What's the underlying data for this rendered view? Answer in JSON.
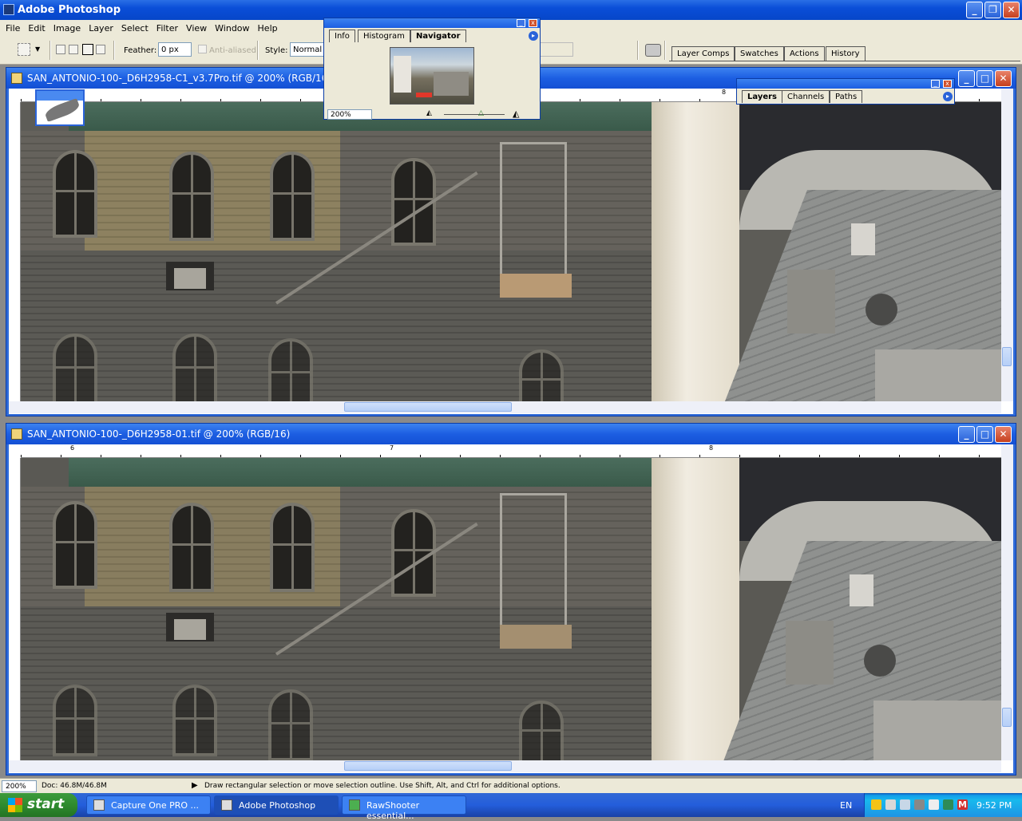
{
  "app": {
    "title": "Adobe Photoshop"
  },
  "menu": [
    "File",
    "Edit",
    "Image",
    "Layer",
    "Select",
    "Filter",
    "View",
    "Window",
    "Help"
  ],
  "options": {
    "feather_label": "Feather:",
    "feather_value": "0 px",
    "anti_aliased": "Anti-aliased",
    "style_label": "Style:",
    "style_value": "Normal"
  },
  "palette_well": [
    "Layer Comps",
    "Swatches",
    "Actions",
    "History"
  ],
  "navigator": {
    "tabs": [
      "Info",
      "Histogram",
      "Navigator"
    ],
    "zoom": "200%"
  },
  "layers_palette": {
    "tabs": [
      "Layers",
      "Channels",
      "Paths"
    ]
  },
  "doc1": {
    "title": "SAN_ANTONIO-100-_D6H2958-C1_v3.7Pro.tif @ 200% (RGB/16)",
    "ruler": [
      "6",
      "7",
      "8"
    ]
  },
  "doc2": {
    "title": "SAN_ANTONIO-100-_D6H2958-01.tif @ 200% (RGB/16)",
    "ruler": [
      "6",
      "7",
      "8"
    ]
  },
  "status": {
    "zoom": "200%",
    "doc": "Doc: 46.8M/46.8M",
    "hint": "Draw rectangular selection or move selection outline.  Use Shift, Alt, and Ctrl for additional options."
  },
  "taskbar": {
    "start": "start",
    "items": [
      "Capture One PRO ...",
      "Adobe Photoshop",
      "RawShooter essential..."
    ],
    "lang": "EN",
    "time": "9:52 PM"
  }
}
